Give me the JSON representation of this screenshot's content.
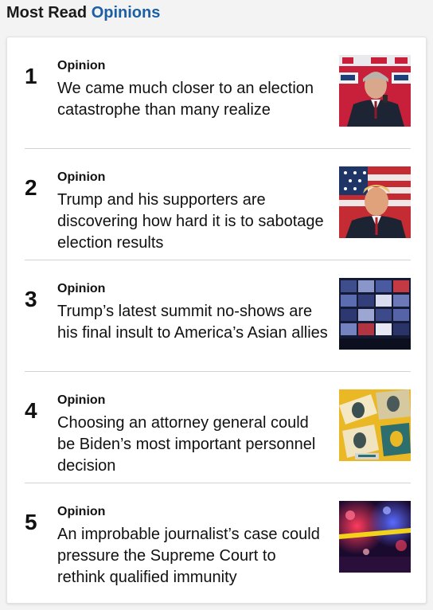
{
  "header": {
    "title_prefix": "Most Read",
    "title_accent": "Opinions",
    "accent_color": "#1d5fa3"
  },
  "items": [
    {
      "rank": "1",
      "kicker": "Opinion",
      "headline": "We came much closer to an election catastrophe than many realize",
      "thumbnail": "photo-man-at-podium-red-banner"
    },
    {
      "rank": "2",
      "kicker": "Opinion",
      "headline": "Trump and his supporters are discovering how hard it is to sabotage election results",
      "thumbnail": "photo-man-before-flag"
    },
    {
      "rank": "3",
      "kicker": "Opinion",
      "headline": "Trump’s latest summit no-shows are his final insult to America’s Asian allies",
      "thumbnail": "photo-video-conference-grid"
    },
    {
      "rank": "4",
      "kicker": "Opinion",
      "headline": "Choosing an attorney general could be Biden’s most important personnel decision",
      "thumbnail": "illustration-yellow-collage"
    },
    {
      "rank": "5",
      "kicker": "Opinion",
      "headline": "An improbable journalist’s case could pressure the Supreme Court to rethink qualified immunity",
      "thumbnail": "photo-police-lights-night"
    }
  ]
}
